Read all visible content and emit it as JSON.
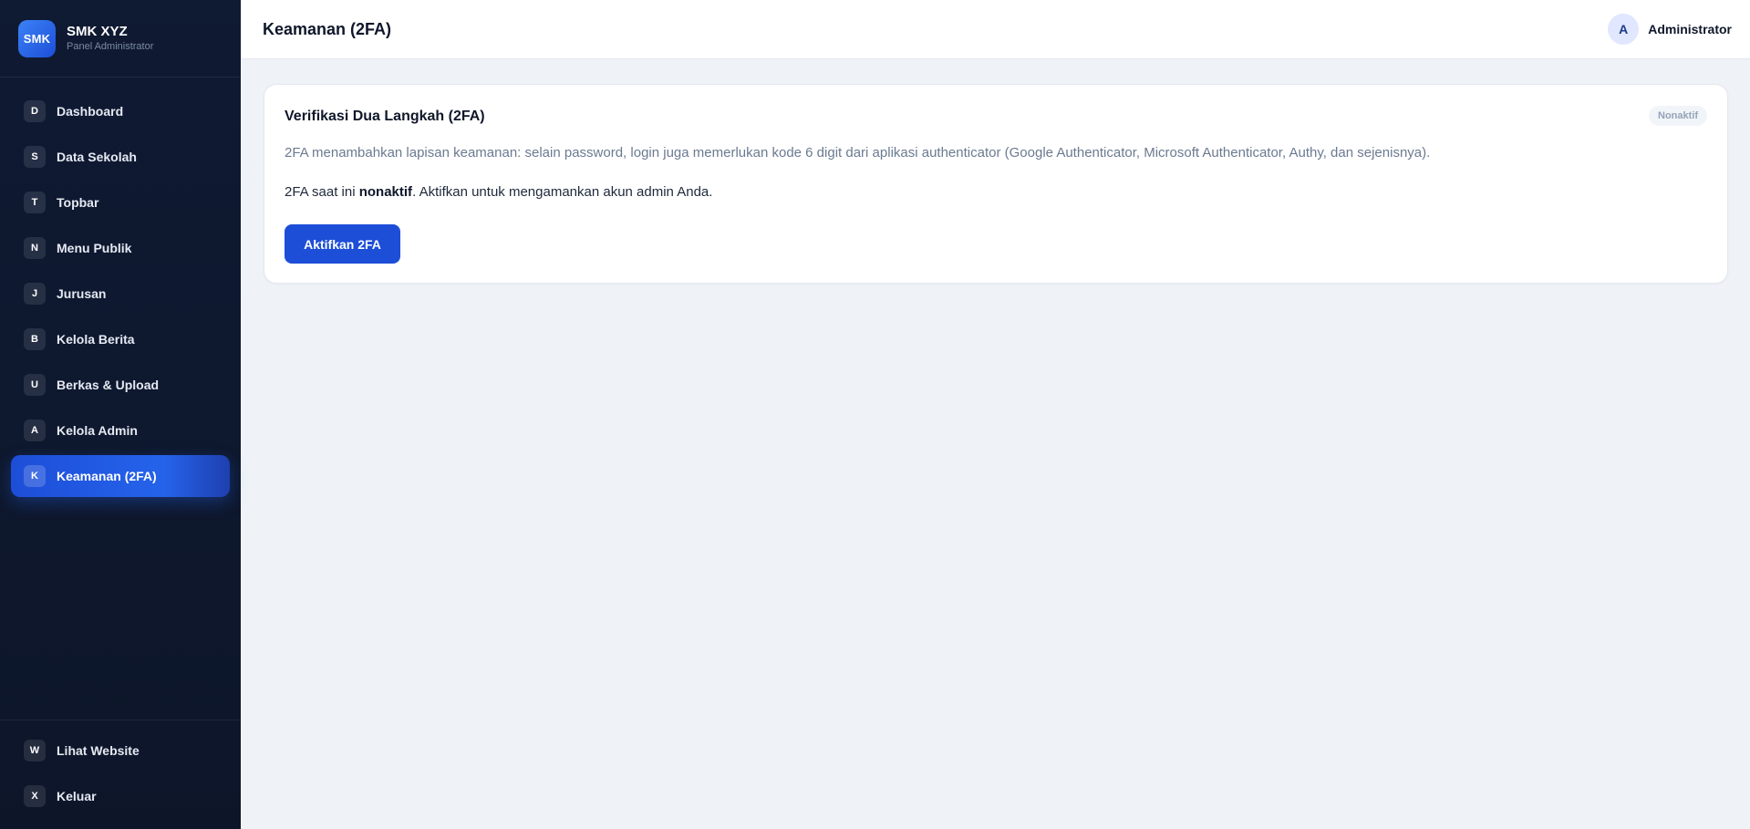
{
  "brand": {
    "logo_text": "SMK",
    "name": "SMK XYZ",
    "subtitle": "Panel Administrator"
  },
  "sidebar": {
    "items": [
      {
        "badge": "D",
        "label": "Dashboard",
        "active": false
      },
      {
        "badge": "S",
        "label": "Data Sekolah",
        "active": false
      },
      {
        "badge": "T",
        "label": "Topbar",
        "active": false
      },
      {
        "badge": "N",
        "label": "Menu Publik",
        "active": false
      },
      {
        "badge": "J",
        "label": "Jurusan",
        "active": false
      },
      {
        "badge": "B",
        "label": "Kelola Berita",
        "active": false
      },
      {
        "badge": "U",
        "label": "Berkas & Upload",
        "active": false
      },
      {
        "badge": "A",
        "label": "Kelola Admin",
        "active": false
      },
      {
        "badge": "K",
        "label": "Keamanan (2FA)",
        "active": true
      }
    ],
    "bottom_items": [
      {
        "badge": "W",
        "label": "Lihat Website"
      },
      {
        "badge": "X",
        "label": "Keluar"
      }
    ]
  },
  "header": {
    "title": "Keamanan (2FA)",
    "user": {
      "avatar_initial": "A",
      "name": "Administrator"
    }
  },
  "card": {
    "title": "Verifikasi Dua Langkah (2FA)",
    "status_badge": "Nonaktif",
    "description": "2FA menambahkan lapisan keamanan: selain password, login juga memerlukan kode 6 digit dari aplikasi authenticator (Google Authenticator, Microsoft Authenticator, Authy, dan sejenisnya).",
    "state_prefix": "2FA saat ini ",
    "state_value": "nonaktif",
    "state_suffix": ". Aktifkan untuk mengamankan akun admin Anda.",
    "action_button": "Aktifkan 2FA"
  },
  "colors": {
    "accent": "#1d4ed8",
    "sidebar_bg": "#0f1a33",
    "page_bg": "#eff3f8"
  }
}
